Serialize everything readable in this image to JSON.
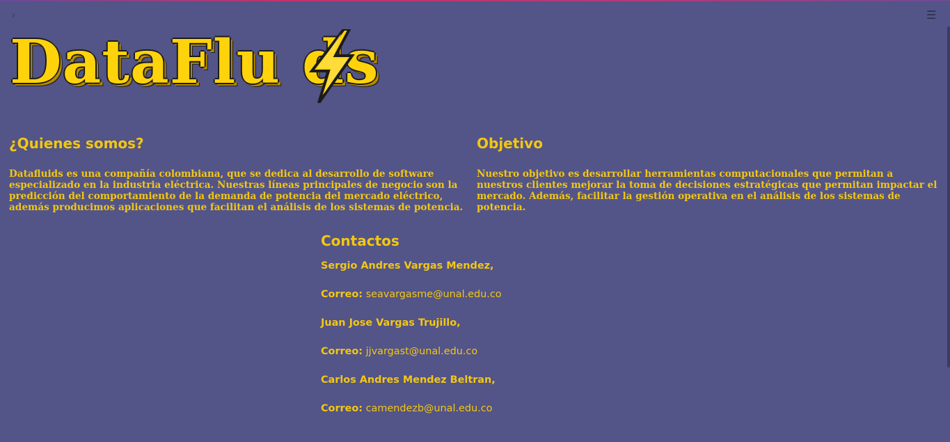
{
  "logo": {
    "text": "DataFlu  ds",
    "alt_letter_icon": "lightning-bolt-icon"
  },
  "about": {
    "title": "¿Quienes somos?",
    "body": "Datafluids es una compañía colombiana, que se dedica al desarrollo de software especializado en la industria eléctrica. Nuestras líneas principales de negocio son la predicción del comportamiento de la demanda de potencia del mercado eléctrico, además producimos aplicaciones que facilitan el análisis de los sistemas de potencia."
  },
  "objective": {
    "title": "Objetivo",
    "body": "Nuestro objetivo es desarrollar herramientas computacionales que permitan a nuestros clientes mejorar la toma de decisiones estratégicas que permitan impactar el mercado. Además, facilitar la gestión operativa en el análisis de los sistemas de potencia."
  },
  "contacts": {
    "title": "Contactos",
    "people": [
      {
        "name": "Sergio Andres Vargas Mendez,",
        "email_label": "Correo:",
        "email": "seavargasme@unal.edu.co"
      },
      {
        "name": "Juan Jose Vargas Trujillo,",
        "email_label": "Correo:",
        "email": "jjvargast@unal.edu.co"
      },
      {
        "name": "Carlos Andres Mendez Beltran,",
        "email_label": "Correo:",
        "email": "camendezb@unal.edu.co"
      }
    ]
  },
  "icons": {
    "sidebar_toggle": "chevron-right-icon",
    "menu": "hamburger-menu-icon"
  },
  "colors": {
    "background": "#535487",
    "accent": "#f2c713",
    "logo_fill": "#ffd30c"
  }
}
